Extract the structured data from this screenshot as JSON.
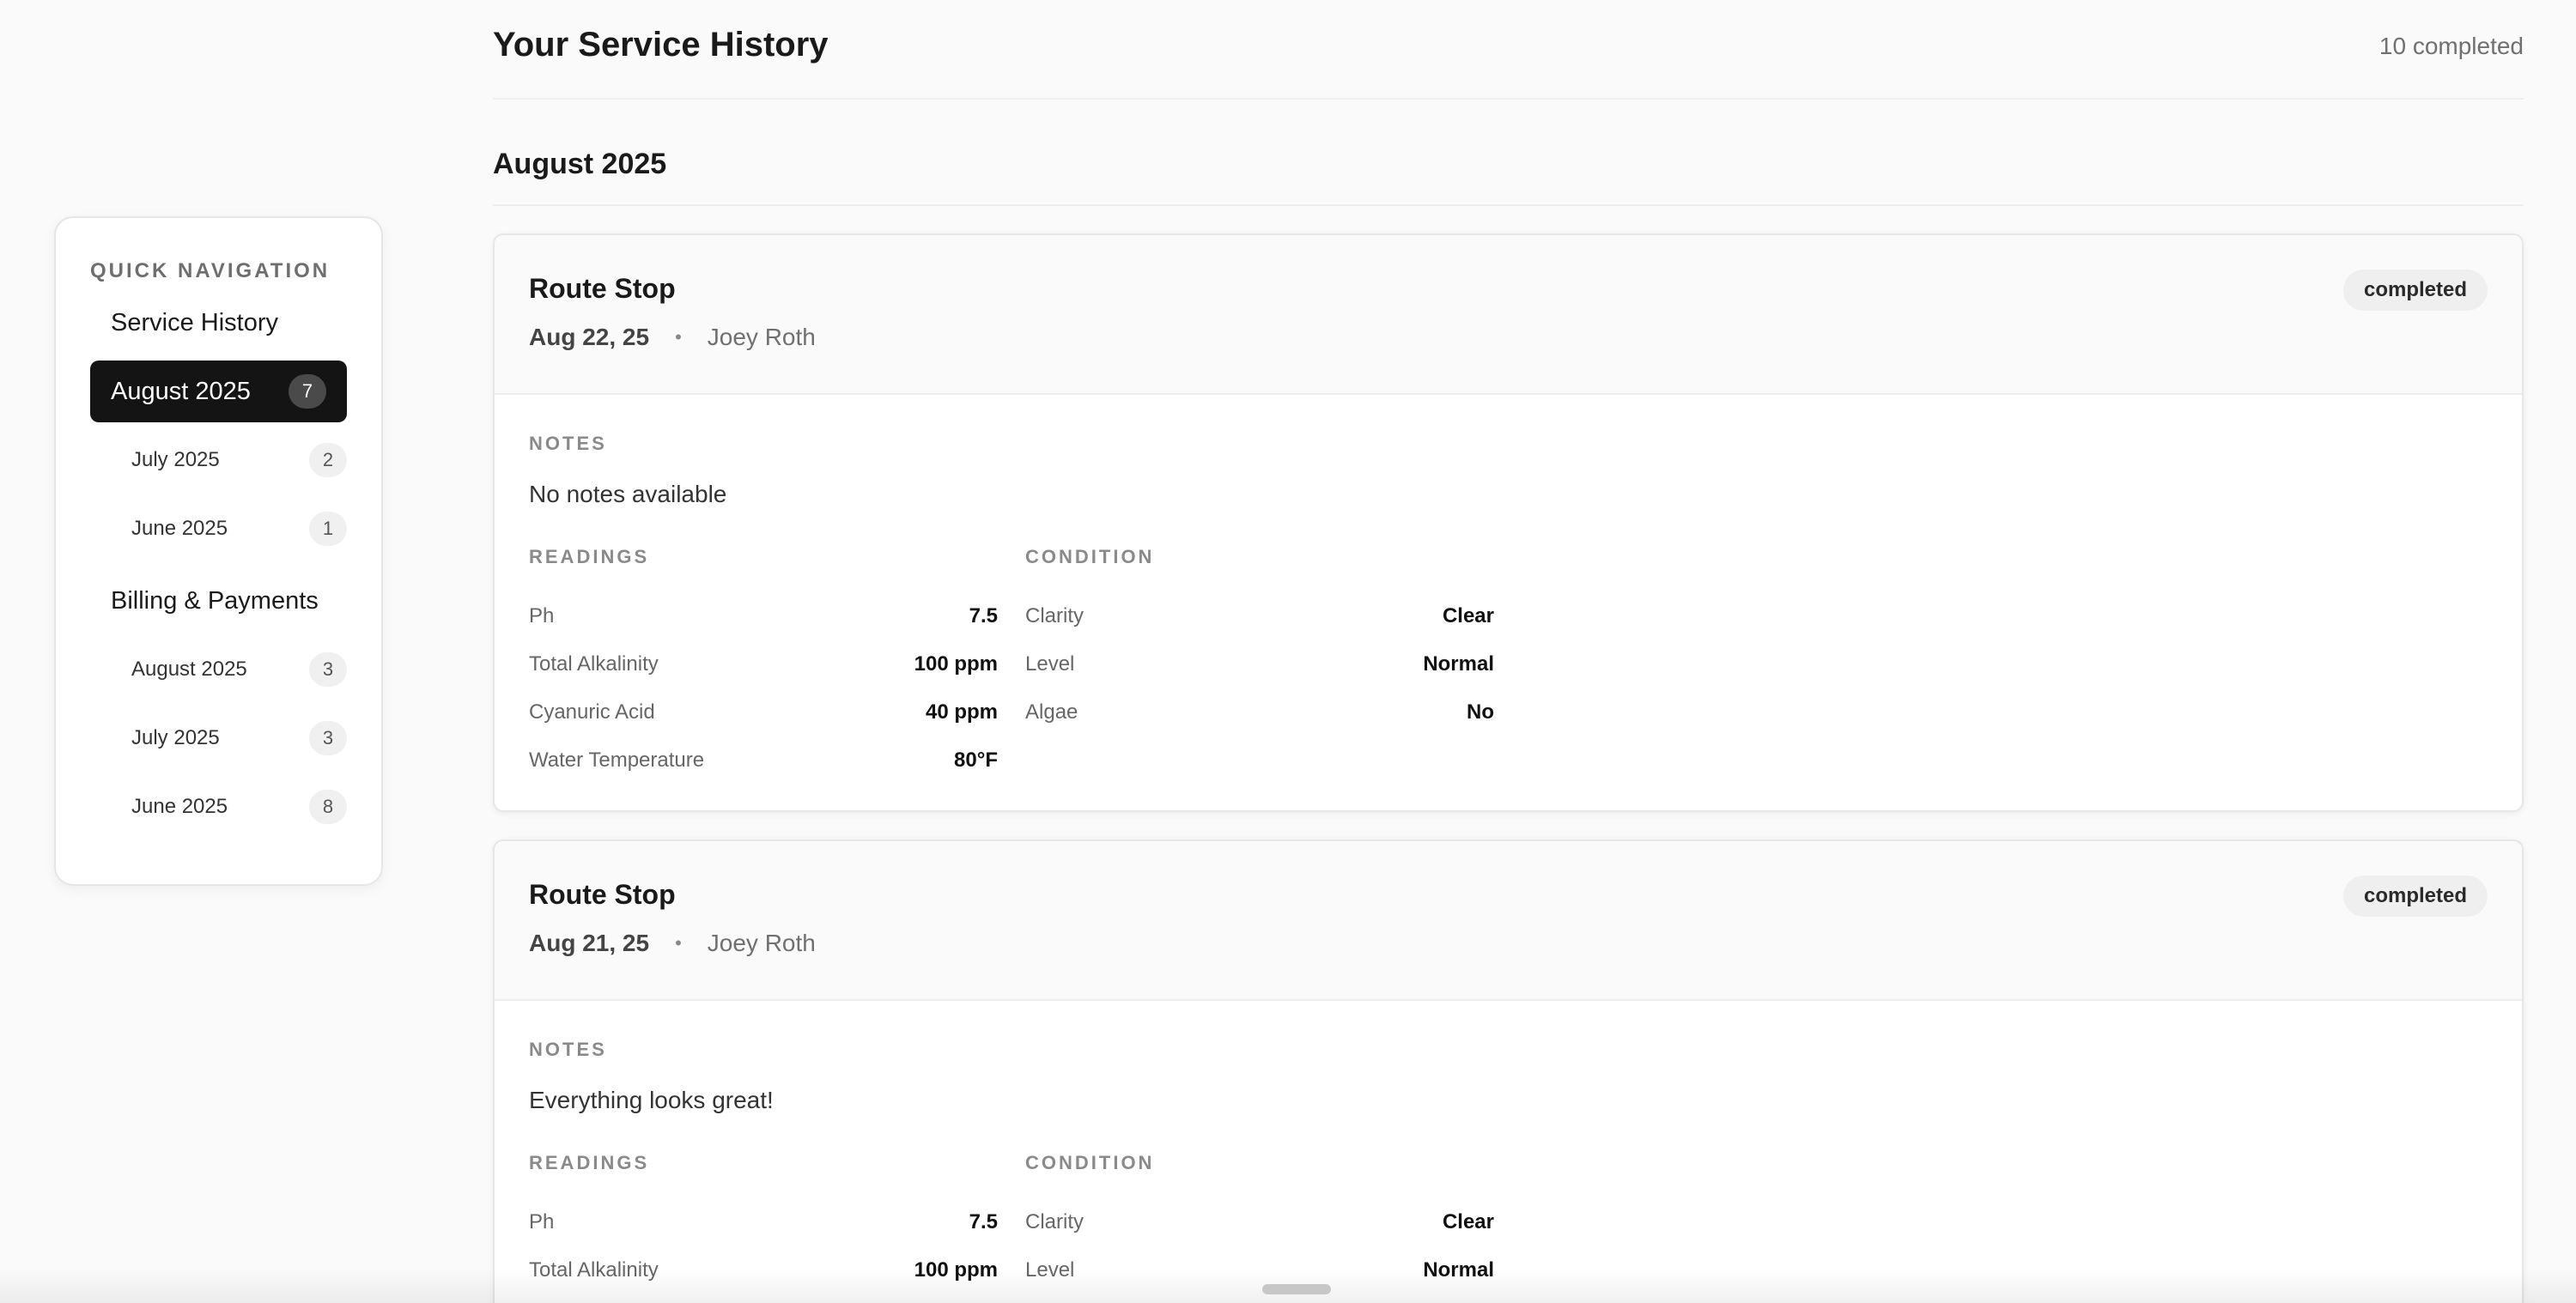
{
  "sidebar": {
    "heading": "QUICK NAVIGATION",
    "service_history": {
      "label": "Service History",
      "items": [
        {
          "label": "August 2025",
          "count": "7"
        },
        {
          "label": "July 2025",
          "count": "2"
        },
        {
          "label": "June 2025",
          "count": "1"
        }
      ]
    },
    "billing": {
      "label": "Billing & Payments",
      "items": [
        {
          "label": "August 2025",
          "count": "3"
        },
        {
          "label": "July 2025",
          "count": "3"
        },
        {
          "label": "June 2025",
          "count": "8"
        }
      ]
    }
  },
  "header": {
    "title": "Your Service History",
    "completed_count": "10 completed"
  },
  "month": "August 2025",
  "cards": [
    {
      "title": "Route Stop",
      "date": "Aug 22, 25",
      "separator": "•",
      "technician": "Joey Roth",
      "status": "completed",
      "notes_label": "NOTES",
      "notes": "No notes available",
      "readings_label": "READINGS",
      "condition_label": "CONDITION",
      "readings": [
        {
          "label": "Ph",
          "value": "7.5"
        },
        {
          "label": "Total Alkalinity",
          "value": "100 ppm"
        },
        {
          "label": "Cyanuric Acid",
          "value": "40 ppm"
        },
        {
          "label": "Water Temperature",
          "value": "80°F"
        }
      ],
      "condition": [
        {
          "label": "Clarity",
          "value": "Clear"
        },
        {
          "label": "Level",
          "value": "Normal"
        },
        {
          "label": "Algae",
          "value": "No"
        }
      ]
    },
    {
      "title": "Route Stop",
      "date": "Aug 21, 25",
      "separator": "•",
      "technician": "Joey Roth",
      "status": "completed",
      "notes_label": "NOTES",
      "notes": "Everything looks great!",
      "readings_label": "READINGS",
      "condition_label": "CONDITION",
      "readings": [
        {
          "label": "Ph",
          "value": "7.5"
        },
        {
          "label": "Total Alkalinity",
          "value": "100 ppm"
        }
      ],
      "condition": [
        {
          "label": "Clarity",
          "value": "Clear"
        },
        {
          "label": "Level",
          "value": "Normal"
        }
      ]
    }
  ]
}
